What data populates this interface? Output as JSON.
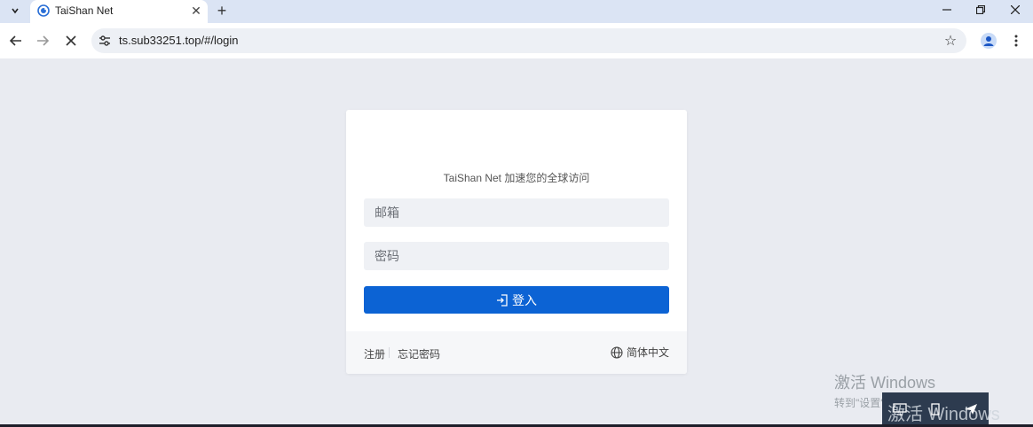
{
  "browser": {
    "tab_title": "TaiShan Net",
    "new_tab_glyph": "+",
    "url": "ts.sub33251.top/#/login"
  },
  "login": {
    "subtitle": "TaiShan Net 加速您的全球访问",
    "email_placeholder": "邮箱",
    "password_placeholder": "密码",
    "login_label": "登入",
    "register_label": "注册",
    "forgot_label": "忘记密码",
    "language_label": "简体中文"
  },
  "overlay": {
    "activate_title": "激活 Windows",
    "activate_sub": "转到\"设置\"以激活 Windows。",
    "ghost_text": "激活 Windows"
  },
  "colors": {
    "accent": "#0c63d4",
    "page_bg": "#e9ebf1",
    "tabbar_bg": "#dbe4f4"
  }
}
